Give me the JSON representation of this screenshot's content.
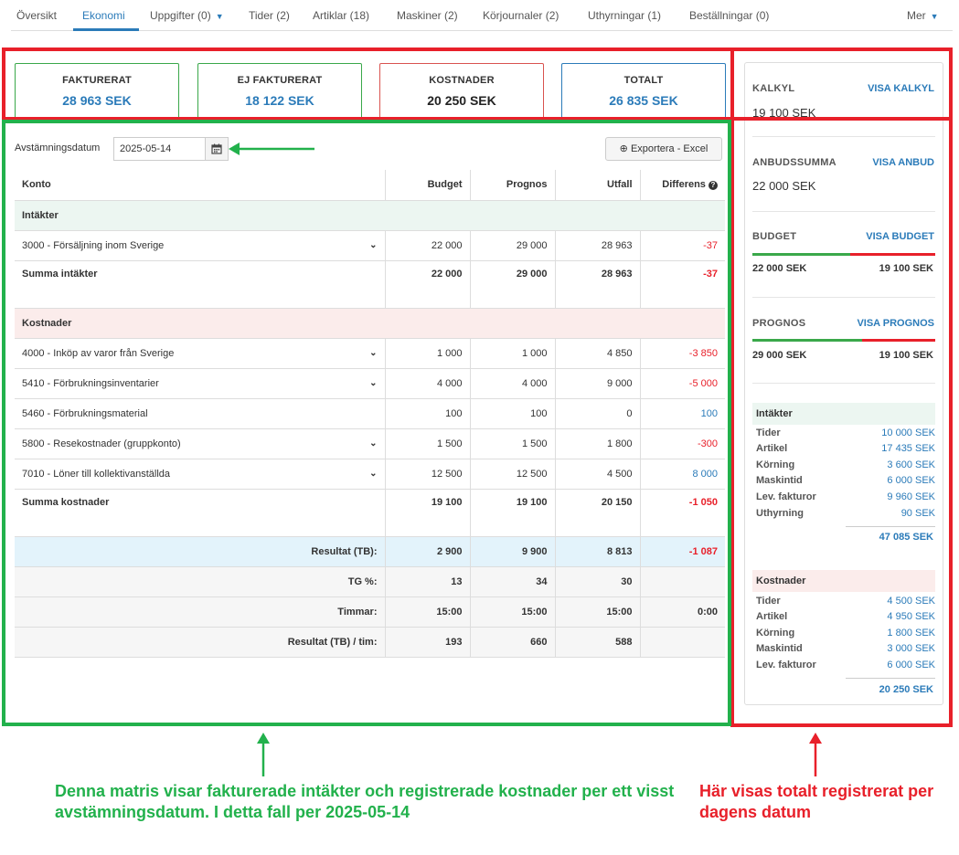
{
  "nav": {
    "tabs": [
      {
        "label": "Översikt"
      },
      {
        "label": "Ekonomi"
      },
      {
        "label": "Uppgifter (0)"
      },
      {
        "label": "Tider (2)"
      },
      {
        "label": "Artiklar (18)"
      },
      {
        "label": "Maskiner (2)"
      },
      {
        "label": "Körjournaler (2)"
      },
      {
        "label": "Uthyrningar (1)"
      },
      {
        "label": "Beställningar (0)"
      }
    ],
    "more": "Mer"
  },
  "cards": [
    {
      "label": "FAKTURERAT",
      "value": "28 963 SEK",
      "color": "#2b7bb9"
    },
    {
      "label": "EJ FAKTURERAT",
      "value": "18 122 SEK",
      "color": "#2b7bb9"
    },
    {
      "label": "KOSTNADER",
      "value": "20 250 SEK",
      "color": "#222222"
    },
    {
      "label": "TOTALT",
      "value": "26 835 SEK",
      "color": "#2b7bb9"
    }
  ],
  "toolbar": {
    "date_label": "Avstämningsdatum",
    "date_value": "2025-05-14",
    "export_label": "Exportera - Excel"
  },
  "table": {
    "headers": [
      "Konto",
      "Budget",
      "Prognos",
      "Utfall",
      "Differens"
    ],
    "income_group": "Intäkter",
    "income_rows": [
      [
        "3000 - Försäljning inom Sverige",
        "22 000",
        "29 000",
        "28 963",
        "-37"
      ]
    ],
    "income_sum": [
      "Summa intäkter",
      "22 000",
      "29 000",
      "28 963",
      "-37"
    ],
    "cost_group": "Kostnader",
    "cost_rows": [
      [
        "4000 - Inköp av varor från Sverige",
        "1 000",
        "1 000",
        "4 850",
        "-3 850"
      ],
      [
        "5410 - Förbrukningsinventarier",
        "4 000",
        "4 000",
        "9 000",
        "-5 000"
      ],
      [
        "5460 - Förbrukningsmaterial",
        "100",
        "100",
        "0",
        "100"
      ],
      [
        "5800 - Resekostnader (gruppkonto)",
        "1 500",
        "1 500",
        "1 800",
        "-300"
      ],
      [
        "7010 - Löner till kollektivanställda",
        "12 500",
        "12 500",
        "4 500",
        "8 000"
      ]
    ],
    "cost_sum": [
      "Summa kostnader",
      "19 100",
      "19 100",
      "20 150",
      "-1 050"
    ],
    "results": [
      [
        "Resultat (TB):",
        "2 900",
        "9 900",
        "8 813",
        "-1 087"
      ],
      [
        "TG %:",
        "13",
        "34",
        "30",
        ""
      ],
      [
        "Timmar:",
        "15:00",
        "15:00",
        "15:00",
        "0:00"
      ],
      [
        "Resultat (TB) / tim:",
        "193",
        "660",
        "588",
        ""
      ]
    ]
  },
  "sidebar": {
    "kalkyl": {
      "label": "KALKYL",
      "link": "VISA KALKYL",
      "value": "19 100 SEK"
    },
    "anbud": {
      "label": "ANBUDSSUMMA",
      "link": "VISA ANBUD",
      "value": "22 000 SEK"
    },
    "budget": {
      "label": "BUDGET",
      "link": "VISA BUDGET",
      "left": "22 000 SEK",
      "right": "19 100 SEK",
      "green_share": 0.535
    },
    "prognos": {
      "label": "PROGNOS",
      "link": "VISA PROGNOS",
      "left": "29 000 SEK",
      "right": "19 100 SEK",
      "green_share": 0.6
    },
    "income": {
      "title": "Intäkter",
      "items": [
        {
          "k": "Tider",
          "v": "10 000 SEK"
        },
        {
          "k": "Artikel",
          "v": "17 435 SEK"
        },
        {
          "k": "Körning",
          "v": "3 600 SEK"
        },
        {
          "k": "Maskintid",
          "v": "6 000 SEK"
        },
        {
          "k": "Lev. fakturor",
          "v": "9 960 SEK"
        },
        {
          "k": "Uthyrning",
          "v": "90 SEK"
        }
      ],
      "total": "47 085 SEK"
    },
    "costs": {
      "title": "Kostnader",
      "items": [
        {
          "k": "Tider",
          "v": "4 500 SEK"
        },
        {
          "k": "Artikel",
          "v": "4 950 SEK"
        },
        {
          "k": "Körning",
          "v": "1 800 SEK"
        },
        {
          "k": "Maskintid",
          "v": "3 000 SEK"
        },
        {
          "k": "Lev. fakturor",
          "v": "6 000 SEK"
        }
      ],
      "total": "20 250 SEK"
    }
  },
  "annotations": {
    "green": "Denna matris visar fakturerade intäkter och registrerade kostnader per ett visst avstämningsdatum. I detta fall per 2025-05-14",
    "red": "Här visas totalt registrerat per dagens datum"
  }
}
